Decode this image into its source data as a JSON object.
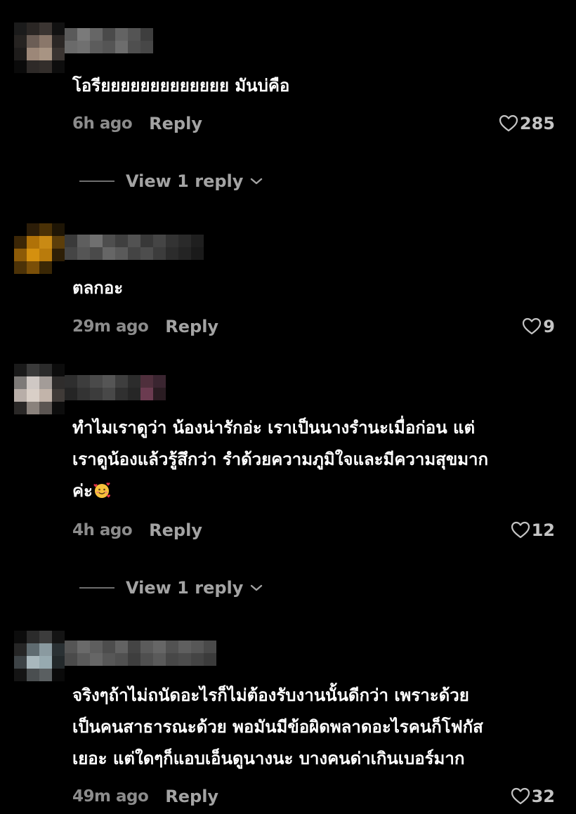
{
  "comments": [
    {
      "text": "โอรียยยยยยยยยยยยย มันบ่คือ",
      "time": "6h ago",
      "reply_label": "Reply",
      "likes": "285",
      "view_replies": "View 1 reply"
    },
    {
      "text": "ตลกอะ",
      "time": "29m ago",
      "reply_label": "Reply",
      "likes": "9"
    },
    {
      "text_lines": [
        "ทำไมเราดูว่า น้องน่ารักอ่ะ เราเป็นนางรำนะเมื่อก่อน แต่",
        "เราดูน้องแล้วรู้สึกว่า รำด้วยความภูมิใจและมีความสุขมาก",
        "ค่ะ"
      ],
      "emoji": "smiling-face-with-hearts",
      "time": "4h ago",
      "reply_label": "Reply",
      "likes": "12",
      "view_replies": "View 1 reply"
    },
    {
      "text_lines": [
        "จริงๆถ้าไม่ถนัดอะไรก็ไม่ต้องรับงานนั้นดีกว่า เพราะด้วย",
        "เป็นคนสาธารณะด้วย พอมันมีข้อผิดพลาดอะไรคนก็โฟกัส",
        "เยอะ แต่ใดๆก็แอบเอ็นดูนางนะ บางคนด่าเกินเบอร์มาก"
      ],
      "time": "49m ago",
      "reply_label": "Reply",
      "likes": "32"
    }
  ],
  "icons": {
    "like": "heart-outline-icon",
    "expand": "chevron-down-icon"
  },
  "colors": {
    "background": "#000000",
    "text": "#ffffff",
    "muted": "#8c8c8c",
    "action": "#a3a3a3"
  }
}
